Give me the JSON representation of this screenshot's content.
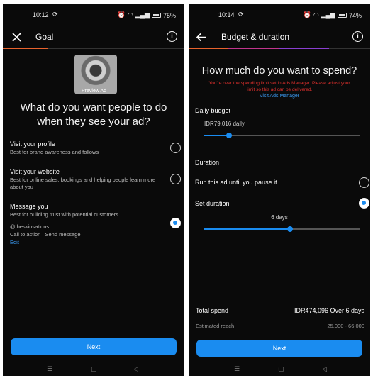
{
  "left": {
    "status": {
      "time": "10:12",
      "sync_icon": "sync-icon",
      "battery": "75%"
    },
    "header": {
      "title": "Goal",
      "close_icon": "close-icon",
      "info_icon": "info-icon"
    },
    "preview": {
      "label": "Preview Ad"
    },
    "question": "What do you want people to do when they see your ad?",
    "options": [
      {
        "title": "Visit your profile",
        "desc": "Best for brand awareness and follows",
        "selected": false
      },
      {
        "title": "Visit your website",
        "desc": "Best for online sales, bookings and helping people learn more about you",
        "selected": false
      },
      {
        "title": "Message you",
        "desc": "Best for building trust with potential customers",
        "selected": true
      }
    ],
    "account": "@theskinsations",
    "cta": "Call to action | Send message",
    "edit_link": "Edit",
    "next_button": "Next"
  },
  "right": {
    "status": {
      "time": "10:14",
      "sync_icon": "sync-icon",
      "battery": "74%"
    },
    "header": {
      "title": "Budget & duration",
      "back_icon": "back-arrow-icon",
      "info_icon": "info-icon"
    },
    "question": "How much do you want to spend?",
    "warning": "You're over the spending limit set in Ads Manager. Please adjust your limit so this ad can be delivered.",
    "warning_link": "Visit Ads Manager",
    "daily_budget_label": "Daily budget",
    "daily_budget_value": "IDR79,016 daily",
    "daily_budget_level": 0.16,
    "duration_label": "Duration",
    "run_until_paused": "Run this ad until you pause it",
    "set_duration": "Set duration",
    "duration_days": "6 days",
    "duration_level": 0.55,
    "total_spend_label": "Total spend",
    "total_spend_value": "IDR474,096 Over 6 days",
    "estimated_reach_label": "Estimated reach",
    "estimated_reach_value": "25,000 - 66,000",
    "next_button": "Next"
  },
  "colors": {
    "accent": "#1a8cf0",
    "warning": "#e0302d",
    "background": "#0a0a0a"
  }
}
